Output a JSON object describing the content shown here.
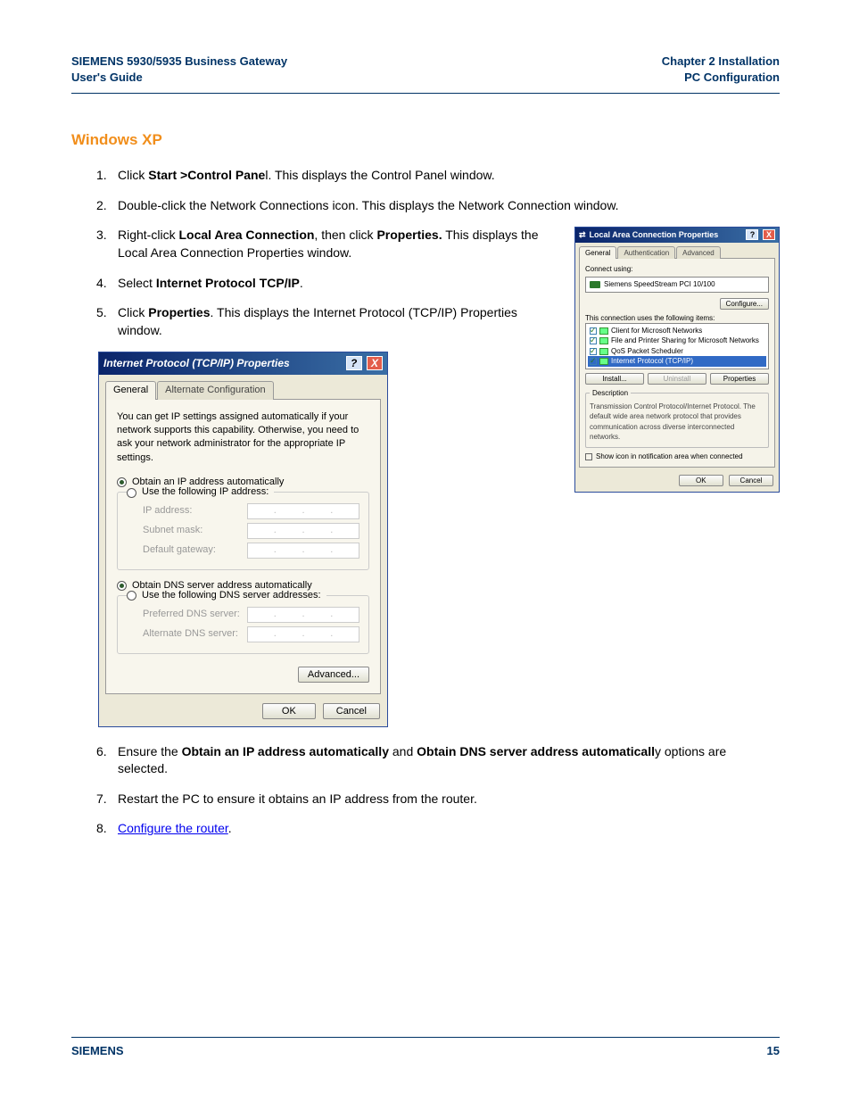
{
  "header": {
    "left_line1": "SIEMENS 5930/5935 Business Gateway",
    "left_line2": "User's Guide",
    "right_line1": "Chapter 2  Installation",
    "right_line2": "PC Configuration"
  },
  "section_title": "Windows XP",
  "steps": {
    "s1_num": "1.",
    "s1_a": "Click ",
    "s1_b": "Start >Control Pane",
    "s1_c": "l. This displays the Control Panel window.",
    "s2_num": "2.",
    "s2": "Double-click the Network Connections icon. This displays the Network Connection window.",
    "s3_num": "3.",
    "s3_a": "Right-click ",
    "s3_b": "Local Area Connection",
    "s3_c": ", then click ",
    "s3_d": "Properties.",
    "s3_e": " This displays the Local Area Connection Properties window.",
    "s4_num": "4.",
    "s4_a": "Select ",
    "s4_b": "Internet Protocol TCP/IP",
    "s4_c": ".",
    "s5_num": "5.",
    "s5_a": "Click ",
    "s5_b": "Properties",
    "s5_c": ". This displays the Internet Protocol (TCP/IP) Properties window.",
    "s6_num": "6.",
    "s6_a": "Ensure the ",
    "s6_b": "Obtain an IP address automatically",
    "s6_c": " and ",
    "s6_d": "Obtain DNS server address automaticall",
    "s6_e": "y options are selected.",
    "s7_num": "7.",
    "s7": "Restart the PC to ensure it obtains an IP address from the router.",
    "s8_num": "8.",
    "s8_link": "Configure the router",
    "s8_tail": "."
  },
  "lap_dialog": {
    "title": "Local Area Connection Properties",
    "tab_general": "General",
    "tab_auth": "Authentication",
    "tab_adv": "Advanced",
    "connect_using": "Connect using:",
    "adapter": "Siemens SpeedStream PCI 10/100",
    "btn_configure": "Configure...",
    "uses_items": "This connection uses the following items:",
    "item1": "Client for Microsoft Networks",
    "item2": "File and Printer Sharing for Microsoft Networks",
    "item3": "QoS Packet Scheduler",
    "item4": "Internet Protocol (TCP/IP)",
    "btn_install": "Install...",
    "btn_uninstall": "Uninstall",
    "btn_properties": "Properties",
    "desc_legend": "Description",
    "desc_text": "Transmission Control Protocol/Internet Protocol. The default wide area network protocol that provides communication across diverse interconnected networks.",
    "chk_notify": "Show icon in notification area when connected",
    "btn_ok": "OK",
    "btn_cancel": "Cancel"
  },
  "tcpip_dialog": {
    "title": "Internet Protocol (TCP/IP) Properties",
    "tab_general": "General",
    "tab_alt": "Alternate Configuration",
    "intro": "You can get IP settings assigned automatically if your network supports this capability. Otherwise, you need to ask your network administrator for the appropriate IP settings.",
    "r1": "Obtain an IP address automatically",
    "r2": "Use the following IP address:",
    "f_ip": "IP address:",
    "f_subnet": "Subnet mask:",
    "f_gateway": "Default gateway:",
    "r3": "Obtain DNS server address automatically",
    "r4": "Use the following DNS server addresses:",
    "f_pref_dns": "Preferred DNS server:",
    "f_alt_dns": "Alternate DNS server:",
    "btn_advanced": "Advanced...",
    "btn_ok": "OK",
    "btn_cancel": "Cancel"
  },
  "footer": {
    "brand": "SIEMENS",
    "page": "15"
  }
}
